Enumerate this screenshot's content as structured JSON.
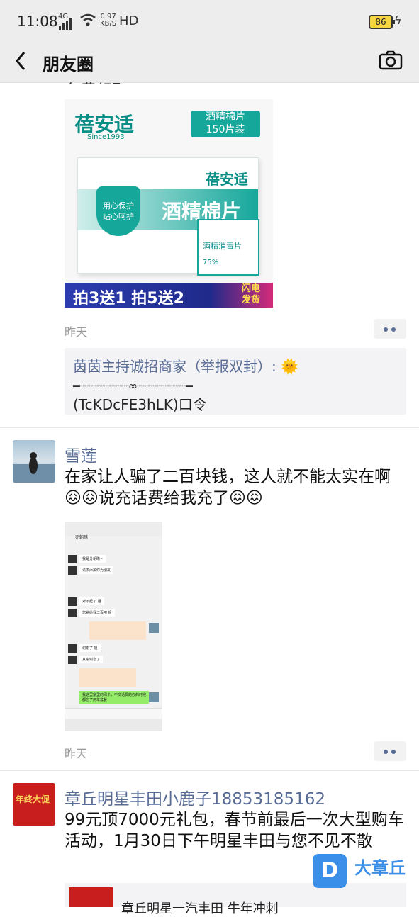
{
  "status": {
    "time": "11:08",
    "network": "4G",
    "speed_value": "0.97",
    "speed_unit": "KB/S",
    "hd": "HD",
    "battery": "86"
  },
  "nav": {
    "title": "朋友圈"
  },
  "post1": {
    "cut_text": "免费领取",
    "ad": {
      "brand": "蓓安适",
      "since": "Since1993",
      "product": "酒精棉片",
      "count": "150片装",
      "box_brand": "蓓安适",
      "box_title": "酒精棉片",
      "pack_title": "酒精消毒片",
      "pack_alc": "75%",
      "tag1": "用心保护",
      "tag2": "贴心呵护",
      "promo": "拍3送1 拍5送2",
      "flash1": "闪电",
      "flash2": "发货"
    },
    "date": "昨天",
    "comment": {
      "name": "茵茵主持诚招商家（举报双封）:",
      "emoji": "🌞",
      "line": "━┈┈┈┈┈┈┈┈∞┈┈┈┈┈┈┈┈━",
      "code": "(TcKDcFE3hLK)口令"
    }
  },
  "post2": {
    "name": "雪莲",
    "text": "在家让人骗了二百块钱，这人就不能太实在啊😖😖说充话费给我充了😖😖",
    "date": "昨天",
    "chat": {
      "title": "亦朝瞧",
      "m1": "我是分朝瞧~",
      "m2": "请求添加你为朋友",
      "m3": "对不起了 姐",
      "m4": "您避给我二百吧 姐",
      "m5": "谢谢了 姐",
      "m6": "真谢谢您了",
      "m7": "我这里家里的网卡，不交话费的办的时候都忘了两年套餐"
    }
  },
  "post3": {
    "name": "章丘明星丰田小鹿子18853185162",
    "text": "99元顶7000元礼包，春节前最后一次大型购车活动，1月30日下午明星丰田与您不见不散",
    "avatar_text": "年终大促",
    "preview": "章丘明星一汽丰田 牛年冲刺"
  },
  "watermark": {
    "letter": "D",
    "text": "大章丘"
  }
}
